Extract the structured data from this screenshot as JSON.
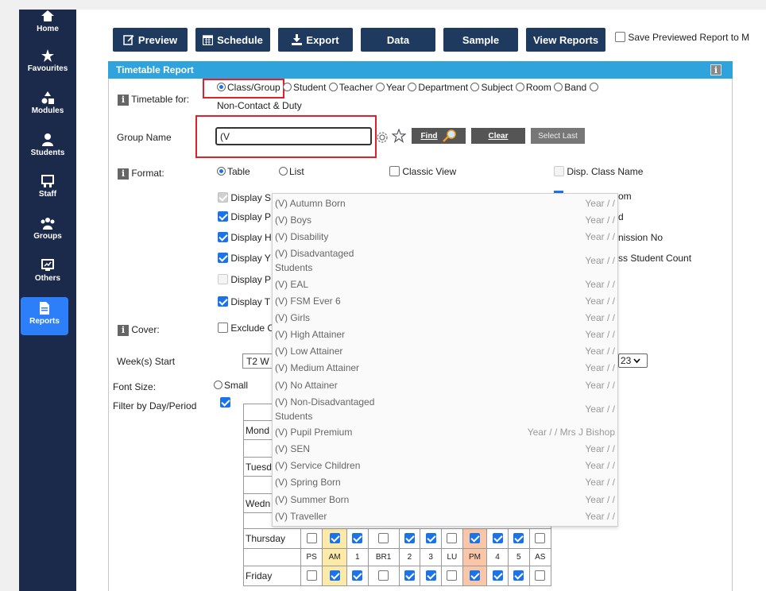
{
  "sidebar": {
    "items": [
      {
        "label": "Home",
        "icon": "home-icon"
      },
      {
        "label": "Favourites",
        "icon": "star-icon"
      },
      {
        "label": "Modules",
        "icon": "modules-icon"
      },
      {
        "label": "Students",
        "icon": "user-icon"
      },
      {
        "label": "Staff",
        "icon": "staff-icon"
      },
      {
        "label": "Groups",
        "icon": "groups-icon"
      },
      {
        "label": "Others",
        "icon": "others-icon"
      },
      {
        "label": "Reports",
        "icon": "reports-icon"
      }
    ]
  },
  "toolbar": {
    "preview": "Preview",
    "schedule": "Schedule",
    "export": "Export",
    "data": "Data",
    "sample": "Sample",
    "view_reports": "View Reports",
    "save_previewed": "Save Previewed Report to M"
  },
  "panel": {
    "title": "Timetable Report",
    "timetable_for_label": "Timetable for:",
    "timetable_options": [
      "Class/Group",
      "Student",
      "Teacher",
      "Year",
      "Department",
      "Subject",
      "Room",
      "Band"
    ],
    "non_contact": "Non-Contact & Duty",
    "group_name_label": "Group Name",
    "group_name_value": "(V",
    "find": "Find",
    "clear": "Clear",
    "select_last": "Select Last",
    "format_label": "Format:",
    "format_table": "Table",
    "format_list": "List",
    "classic_view": "Classic View",
    "disp_class_name": "Disp. Class Name",
    "display_rows": [
      {
        "label": "Display S"
      },
      {
        "label": "Display P"
      },
      {
        "label": "Display H"
      },
      {
        "label": "Display Y"
      },
      {
        "label": "Display P"
      },
      {
        "label": "Display T"
      }
    ],
    "right_partials": [
      "om",
      "d",
      "nission No",
      "ss Student Count"
    ],
    "cover_label": "Cover:",
    "exclude": "Exclude C",
    "weeks_start_label": "Week(s) Start",
    "weeks_start_value": "T2 W",
    "weeks_end_value": "23",
    "font_size_label": "Font Size:",
    "font_small": "Small",
    "filter_label": "Filter by Day/Period"
  },
  "dropdown": {
    "items": [
      {
        "name": "(V) Autumn Born",
        "year": "Year / /"
      },
      {
        "name": "(V) Boys",
        "year": "Year / /"
      },
      {
        "name": "(V) Disability",
        "year": "Year / /"
      },
      {
        "name": "(V) Disadvantaged Students",
        "year": "Year / /"
      },
      {
        "name": "(V) EAL",
        "year": "Year / /"
      },
      {
        "name": "(V) FSM Ever 6",
        "year": "Year / /"
      },
      {
        "name": "(V) Girls",
        "year": "Year / /"
      },
      {
        "name": "(V) High Attainer",
        "year": "Year / /"
      },
      {
        "name": "(V) Low Attainer",
        "year": "Year / /"
      },
      {
        "name": "(V) Medium Attainer",
        "year": "Year / /"
      },
      {
        "name": "(V) No Attainer",
        "year": "Year / /"
      },
      {
        "name": "(V) Non-Disadvantaged Students",
        "year": "Year / /"
      },
      {
        "name": "(V) Pupil Premium",
        "year": "Year / / Mrs J Bishop"
      },
      {
        "name": "(V) SEN",
        "year": "Year / /"
      },
      {
        "name": "(V) Service Children",
        "year": "Year / /"
      },
      {
        "name": "(V) Spring Born",
        "year": "Year / /"
      },
      {
        "name": "(V) Summer Born",
        "year": "Year / /"
      },
      {
        "name": "(V) Traveller",
        "year": "Year / /"
      }
    ]
  },
  "grid": {
    "days_partial": [
      "Mond",
      "Tuesd",
      "Wedn"
    ],
    "thursday": "Thursday",
    "friday": "Friday",
    "periods": [
      "PS",
      "AM",
      "1",
      "BR1",
      "2",
      "3",
      "LU",
      "PM",
      "4",
      "5",
      "AS"
    ],
    "checks": [
      false,
      true,
      true,
      false,
      true,
      true,
      false,
      true,
      true,
      true,
      false
    ]
  },
  "colors": {
    "sidebar": "#1b2a4a",
    "accent": "#2fa3dc",
    "button": "#1f3a5f",
    "highlight": "#e0202a"
  }
}
